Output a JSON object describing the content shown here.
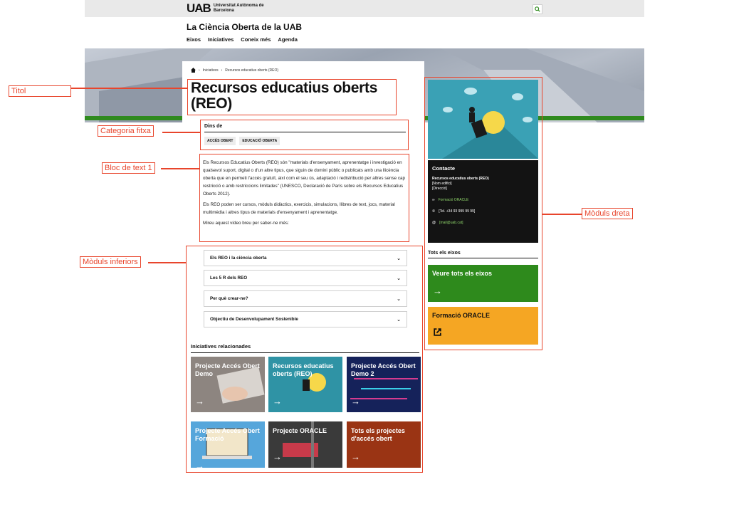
{
  "header": {
    "logo_mark": "UAB",
    "logo_text": "Universitat Autònoma de Barcelona",
    "search_icon": "search-icon"
  },
  "site_title": "La Ciència Oberta de la UAB",
  "nav": [
    "Eixos",
    "Iniciatives",
    "Coneix més",
    "Agenda"
  ],
  "breadcrumb": {
    "home_icon": "home-icon",
    "items": [
      "Iniciatives",
      "Recursos educatius oberts (REO)"
    ]
  },
  "page_title": "Recursos educatius oberts (REO)",
  "category": {
    "label": "Dins de",
    "tags": [
      "ACCÈS OBERT",
      "EDUCACIÓ OBERTA"
    ]
  },
  "body_text": {
    "p1": "Els Recursos Educatius Oberts (REO) són \"materials d'ensenyament, aprenentatge i investigació en qualsevol suport, digital o d'un altre tipus, que siguin de domini públic o publicats amb una llicència oberta que en permeti l'accés gratuït, així com el seu ús, adaptació i redistribució per altres sense cap restricció o amb restriccions limitades\" (UNESCO, Declaració de París sobre els Recursos Educatius Oberts 2012).",
    "p2": "Els REO poden ser cursos, mòduls didàctics, exercicis, simulacions, llibres de text, jocs, material multimèdia i altres tipus de materials d'ensenyament i aprenentatge.",
    "p3": "Mireu aquest vídeo breu per saber-ne més:"
  },
  "accordions": [
    "Els REO i la ciència oberta",
    "Les 5 R dels REO",
    "Per què crear-ne?",
    "Objectiu de Desenvolupament Sostenible"
  ],
  "related": {
    "title": "Iniciatives relacionades",
    "cards": [
      {
        "title": "Projecte Accés Obert Demo",
        "bg": "#8d8580"
      },
      {
        "title": "Recursos educatius oberts (REO)",
        "bg": "#2f93a5"
      },
      {
        "title": "Projecte Accés Obert Demo 2",
        "bg": "#15225a"
      },
      {
        "title": "Projecte Accés Obert Formació",
        "bg": "#56a6db"
      },
      {
        "title": "Projecte ORACLE",
        "bg": "#3a3a3a"
      },
      {
        "title": "Tots els projectes d'accés obert",
        "bg": "#9a3414"
      }
    ],
    "arrow": "→"
  },
  "contact": {
    "title": "Contacte",
    "name": "Recursos educatius oberts (REO)",
    "building": "[Nom edifici]",
    "address": "[Direcció]",
    "link": "Formació ORACLE",
    "phone": "[Tel. +34 93 999 99 99]",
    "email": "[mail@uab.cat]"
  },
  "eixos": {
    "title": "Tots els eixos",
    "btn_all": "Veure tots els eixos",
    "btn_oracle": "Formació ORACLE"
  },
  "annotations": {
    "titol": "Titol",
    "categoria": "Categoria fitxa",
    "bloc": "Bloc de text 1",
    "inferiors": "Mòduls inferiors",
    "dreta": "Mòduls dreta"
  },
  "colors": {
    "annotation": "#e8452c",
    "green": "#2e8a1c",
    "orange": "#f5a623",
    "dark": "#131313"
  }
}
